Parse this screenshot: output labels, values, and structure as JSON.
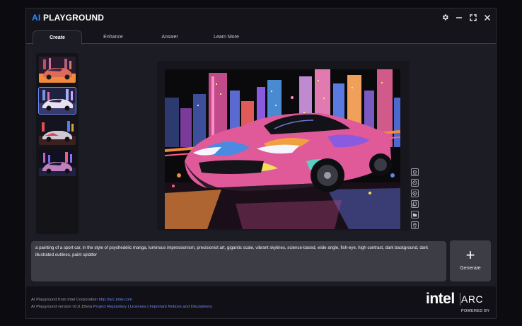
{
  "app": {
    "title_ai": "AI",
    "title_rest": " PLAYGROUND"
  },
  "window_controls": {
    "settings_icon": "gear-icon",
    "minimize_icon": "minimize-icon",
    "fullscreen_icon": "fullscreen-icon",
    "close_icon": "close-icon"
  },
  "tabs": [
    {
      "label": "Create",
      "active": true
    },
    {
      "label": "Enhance",
      "active": false
    },
    {
      "label": "Answer",
      "active": false
    },
    {
      "label": "Learn More",
      "active": false
    }
  ],
  "history": {
    "selected_index": 1
  },
  "preview_tools": [
    "info-icon",
    "history-icon",
    "preview-icon",
    "copy-icon",
    "folder-icon",
    "delete-icon"
  ],
  "prompt": {
    "text": "a painting of a sport car, in the style of psychedelic manga, luminous impressionism, precisionist art, gigantic scale, vibrant skylines, science-based, wide angle, fish-eye, high contrast, dark background, dark illustrated outlines, paint splatter"
  },
  "generate": {
    "plus": "+",
    "label": "Generate"
  },
  "footer": {
    "line1_prefix": "AI Playground from Intel Corporation ",
    "line1_link": "http://arc.intel.com",
    "line2_prefix": "AI Playground version v0.0.1Beta ",
    "line2_link1": "Project Repository",
    "line2_sep1": " | ",
    "line2_link2": "Licenses",
    "line2_sep2": " | ",
    "line2_link3": "Important Notices and Disclaimers"
  },
  "brand": {
    "intel": "intel",
    "arc": "ARC",
    "powered": "POWERED BY"
  },
  "colors": {
    "accent": "#2f8cff",
    "link": "#6f8cff",
    "window_bg": "#1c1c24",
    "prompt_bg": "#3d3d46"
  }
}
